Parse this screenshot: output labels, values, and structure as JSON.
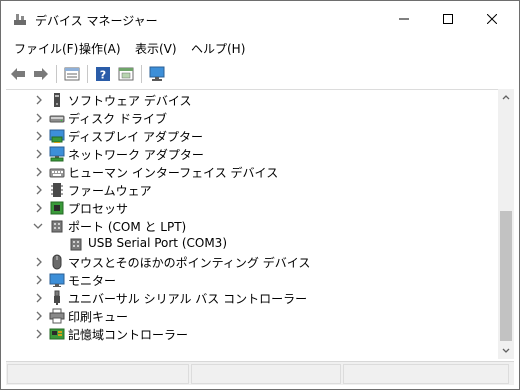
{
  "window": {
    "title": "デバイス マネージャー"
  },
  "menu": {
    "items": [
      "ファイル(F)",
      "操作(A)",
      "表示(V)",
      "ヘルプ(H)"
    ]
  },
  "toolbar": {
    "buttons": [
      "back-icon",
      "forward-icon",
      "properties-view-icon",
      "help-icon",
      "resources-view-icon",
      "monitor-scan-icon"
    ]
  },
  "tree": {
    "items": [
      {
        "label": "ソフトウェア デバイス",
        "icon": "software-device-icon",
        "expanded": false
      },
      {
        "label": "ディスク ドライブ",
        "icon": "disk-drive-icon",
        "expanded": false
      },
      {
        "label": "ディスプレイ アダプター",
        "icon": "display-adapter-icon",
        "expanded": false
      },
      {
        "label": "ネットワーク アダプター",
        "icon": "network-adapter-icon",
        "expanded": false
      },
      {
        "label": "ヒューマン インターフェイス デバイス",
        "icon": "hid-icon",
        "expanded": false
      },
      {
        "label": "ファームウェア",
        "icon": "firmware-icon",
        "expanded": false
      },
      {
        "label": "プロセッサ",
        "icon": "processor-icon",
        "expanded": false
      },
      {
        "label": "ポート (COM と LPT)",
        "icon": "port-icon",
        "expanded": true
      },
      {
        "label": "USB Serial Port (COM3)",
        "icon": "serial-port-icon",
        "child": true
      },
      {
        "label": "マウスとそのほかのポインティング デバイス",
        "icon": "mouse-icon",
        "expanded": false
      },
      {
        "label": "モニター",
        "icon": "monitor-icon",
        "expanded": false
      },
      {
        "label": "ユニバーサル シリアル バス コントローラー",
        "icon": "usb-icon",
        "expanded": false
      },
      {
        "label": "印刷キュー",
        "icon": "printer-icon",
        "expanded": false
      },
      {
        "label": "記憶域コントローラー",
        "icon": "storage-controller-icon",
        "expanded": false
      }
    ]
  },
  "colors": {
    "icon_blue": "#1e6fc8",
    "icon_gray": "#5a5a5a",
    "chevron": "#6e6e6e",
    "scroll_thumb": "#c2c2c2"
  }
}
